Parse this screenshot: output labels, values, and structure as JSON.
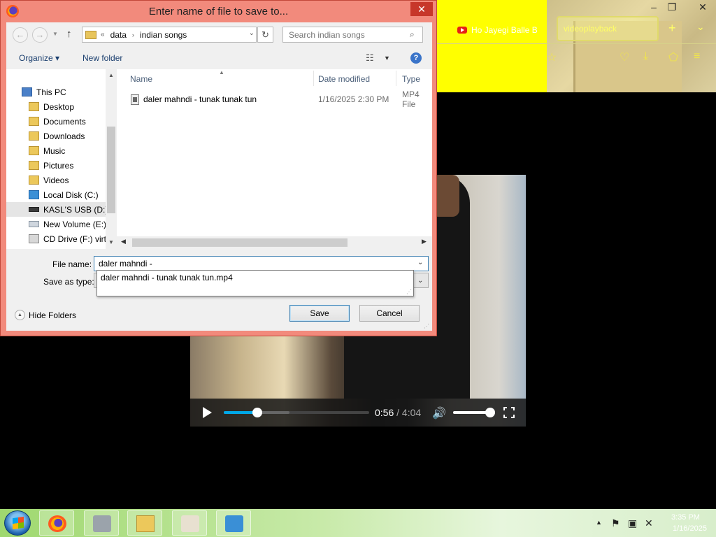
{
  "browser": {
    "tabs": [
      {
        "label": "Ho Jayegi Balle B"
      },
      {
        "label": "videoplayback"
      }
    ],
    "new_tab": "+",
    "tab_list": "⌄",
    "window_controls": {
      "minimize": "–",
      "maximize": "❐",
      "close": "✕"
    },
    "nav_icons": {
      "bookmark": "☆",
      "pocket": "♡",
      "download": "⤓",
      "extensions": "⬠",
      "menu": "≡"
    }
  },
  "video": {
    "current_time": "0:56",
    "separator": " / ",
    "duration": "4:04",
    "progress_fraction": 0.23,
    "buffered_fraction": 0.45,
    "volume_fraction": 0.92,
    "volume_icon": "🔊"
  },
  "dialog": {
    "title": "Enter name of file to save to...",
    "close": "✕",
    "address": {
      "overflow": "«",
      "crumbs": [
        "data",
        "indian songs"
      ],
      "separator": "›"
    },
    "search_placeholder": "Search indian songs",
    "toolbar": {
      "organize": "Organize",
      "new_folder": "New folder",
      "view_icon": "☷",
      "help": "?"
    },
    "nav_tree": [
      {
        "label": "This PC",
        "icon": "pc"
      },
      {
        "label": "Desktop",
        "icon": "folder"
      },
      {
        "label": "Documents",
        "icon": "folder"
      },
      {
        "label": "Downloads",
        "icon": "folder"
      },
      {
        "label": "Music",
        "icon": "folder"
      },
      {
        "label": "Pictures",
        "icon": "folder"
      },
      {
        "label": "Videos",
        "icon": "folder"
      },
      {
        "label": "Local Disk (C:)",
        "icon": "windows-drive"
      },
      {
        "label": "KASL'S USB (D:)",
        "icon": "usb-drive",
        "selected": true
      },
      {
        "label": "New Volume (E:)",
        "icon": "drive"
      },
      {
        "label": "CD Drive (F:) virti",
        "icon": "cd-drive"
      }
    ],
    "columns": {
      "name": "Name",
      "date": "Date modified",
      "type": "Type"
    },
    "files": [
      {
        "name": "daler mahndi - tunak tunak tun",
        "date": "1/16/2025 2:30 PM",
        "type": "MP4 File"
      }
    ],
    "filename_label": "File name:",
    "filename_value": "daler mahndi -",
    "saveas_label": "Save as type:",
    "autocomplete": "daler mahndi - tunak tunak tun.mp4",
    "hide_folders": "Hide Folders",
    "save": "Save",
    "cancel": "Cancel"
  },
  "taskbar": {
    "apps": [
      "firefox",
      "printer",
      "file-explorer",
      "java",
      "network"
    ],
    "tray_time": "3:35 PM",
    "tray_date": "1/16/2025"
  }
}
